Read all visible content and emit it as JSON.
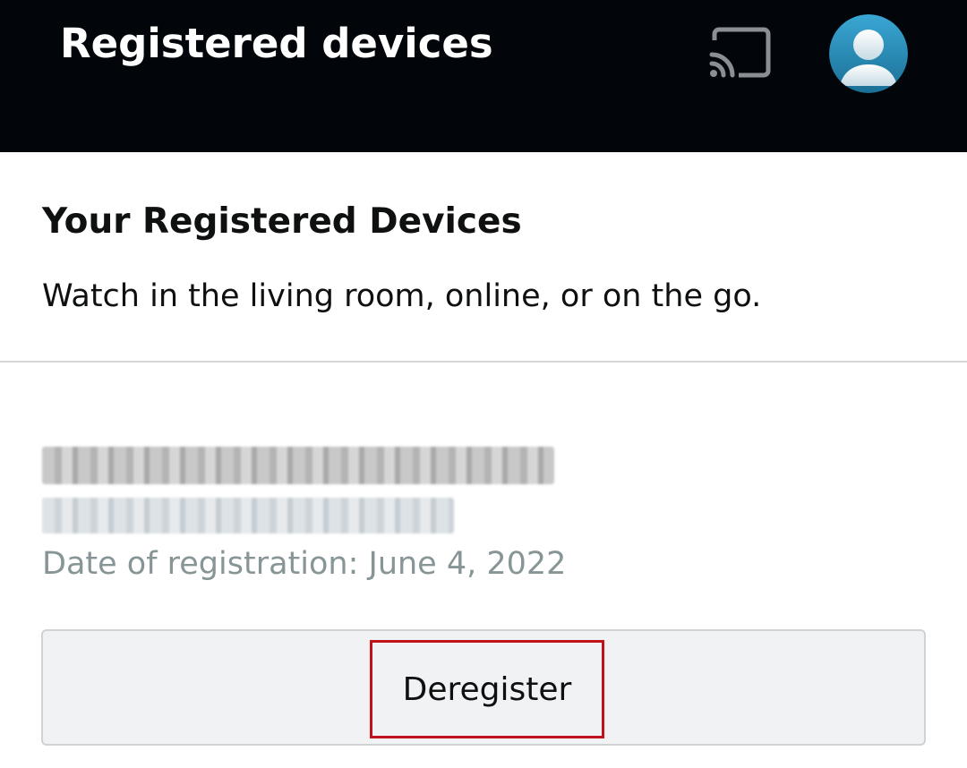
{
  "header": {
    "title": "Registered devices",
    "cast_icon": "cast-icon",
    "avatar_icon": "user-avatar-icon"
  },
  "section": {
    "title": "Your Registered Devices",
    "subtitle": "Watch in the living room, online, or on the go."
  },
  "device": {
    "name_redacted": true,
    "type_redacted": true,
    "registration_date": "Date of registration: June 4, 2022",
    "deregister_label": "Deregister"
  },
  "colors": {
    "header_bg": "#020509",
    "secondary_text": "#879596",
    "highlight": "#c0131b"
  }
}
